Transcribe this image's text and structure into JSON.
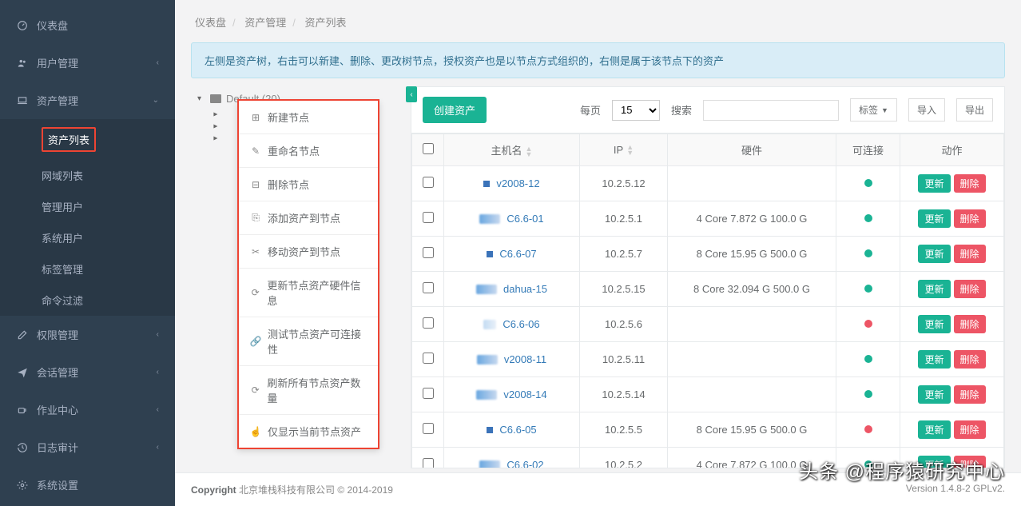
{
  "sidebar": {
    "items": [
      {
        "label": "仪表盘",
        "icon": "dashboard"
      },
      {
        "label": "用户管理",
        "icon": "users",
        "chev": true
      },
      {
        "label": "资产管理",
        "icon": "laptop",
        "chev": true,
        "open": true,
        "children": [
          {
            "label": "资产列表",
            "active": true
          },
          {
            "label": "网域列表"
          },
          {
            "label": "管理用户"
          },
          {
            "label": "系统用户"
          },
          {
            "label": "标签管理"
          },
          {
            "label": "命令过滤"
          }
        ]
      },
      {
        "label": "权限管理",
        "icon": "edit",
        "chev": true
      },
      {
        "label": "会话管理",
        "icon": "send",
        "chev": true
      },
      {
        "label": "作业中心",
        "icon": "coffee",
        "chev": true
      },
      {
        "label": "日志审计",
        "icon": "history",
        "chev": true
      },
      {
        "label": "系统设置",
        "icon": "cogs"
      }
    ]
  },
  "breadcrumb": [
    "仪表盘",
    "资产管理",
    "资产列表"
  ],
  "info": "左侧是资产树，右击可以新建、删除、更改树节点，授权资产也是以节点方式组织的，右侧是属于该节点下的资产",
  "tree": {
    "root": "Default (20)"
  },
  "context_menu": [
    {
      "icon": "plus-sq",
      "label": "新建节点"
    },
    {
      "icon": "pencil",
      "label": "重命名节点"
    },
    {
      "icon": "minus-sq",
      "label": "删除节点"
    },
    {
      "icon": "clone",
      "label": "添加资产到节点"
    },
    {
      "icon": "scissors",
      "label": "移动资产到节点"
    },
    {
      "icon": "refresh",
      "label": "更新节点资产硬件信息"
    },
    {
      "icon": "link",
      "label": "测试节点资产可连接性"
    },
    {
      "icon": "refresh",
      "label": "刷新所有节点资产数量"
    },
    {
      "icon": "hand",
      "label": "仅显示当前节点资产"
    }
  ],
  "toolbar": {
    "create": "创建资产",
    "per_page_label": "每页",
    "per_page_value": "15",
    "search_label": "搜索",
    "tags_label": "标签",
    "import_label": "导入",
    "export_label": "导出"
  },
  "table": {
    "headers": {
      "host": "主机名",
      "ip": "IP",
      "hw": "硬件",
      "conn": "可连接",
      "action": "动作"
    },
    "actions": {
      "update": "更新",
      "delete": "删除"
    },
    "rows": [
      {
        "host": "v2008-12",
        "ip": "10.2.5.12",
        "hw": "",
        "conn": "green",
        "pre": "sq"
      },
      {
        "host": "C6.6-01",
        "ip": "10.2.5.1",
        "hw": "4 Core 7.872 G 100.0 G",
        "conn": "green",
        "pre": "blur"
      },
      {
        "host": "C6.6-07",
        "ip": "10.2.5.7",
        "hw": "8 Core 15.95 G 500.0 G",
        "conn": "green",
        "pre": "sq"
      },
      {
        "host": "dahua-15",
        "ip": "10.2.5.15",
        "hw": "8 Core 32.094 G 500.0 G",
        "conn": "green",
        "pre": "blur"
      },
      {
        "host": "C6.6-06",
        "ip": "10.2.5.6",
        "hw": "",
        "conn": "red",
        "pre": "blur-light"
      },
      {
        "host": "v2008-11",
        "ip": "10.2.5.11",
        "hw": "",
        "conn": "green",
        "pre": "blur"
      },
      {
        "host": "v2008-14",
        "ip": "10.2.5.14",
        "hw": "",
        "conn": "green",
        "pre": "blur"
      },
      {
        "host": "C6.6-05",
        "ip": "10.2.5.5",
        "hw": "8 Core 15.95 G 500.0 G",
        "conn": "red",
        "pre": "sq"
      },
      {
        "host": "C6.6-02",
        "ip": "10.2.5.2",
        "hw": "4 Core 7.872 G 100.0 G",
        "conn": "green",
        "pre": "blur"
      }
    ]
  },
  "footer": {
    "copyright": "Copyright",
    "company": "北京堆栈科技有限公司 © 2014-2019",
    "version": "Version 1.4.8-2 GPLv2."
  },
  "watermark": "头条 @程序猿研究中心"
}
